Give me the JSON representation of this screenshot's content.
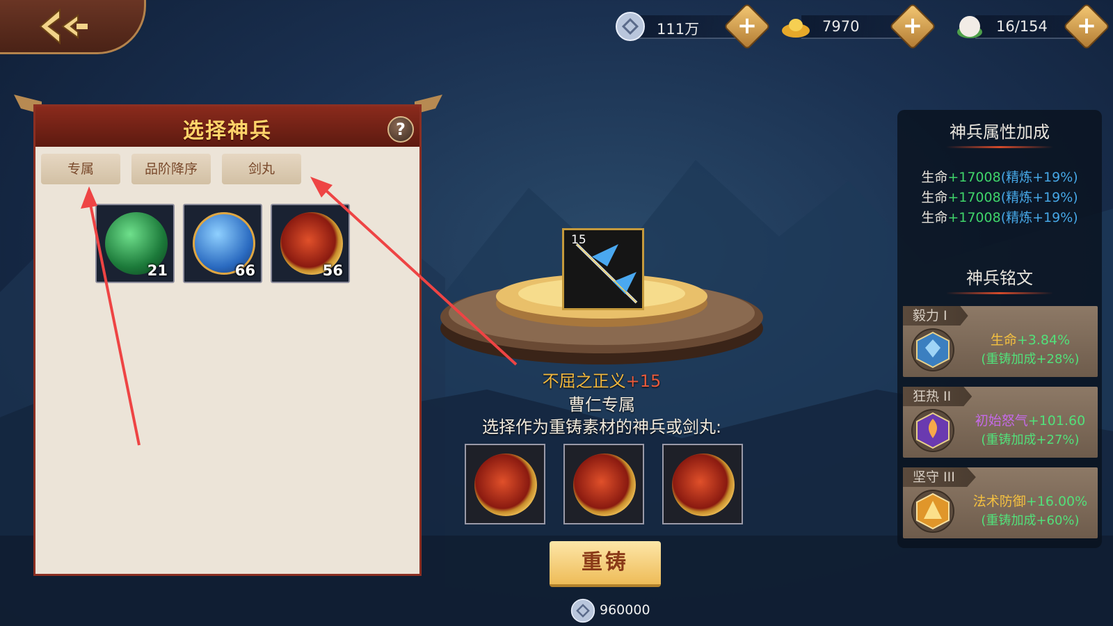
{
  "currency": [
    {
      "icon": "silver-coin-icon",
      "value": "111万"
    },
    {
      "icon": "gold-ingot-icon",
      "value": "7970"
    },
    {
      "icon": "bun-stamina-icon",
      "value": "16/154"
    }
  ],
  "left_panel": {
    "title": "选择神兵",
    "tabs": [
      "专属",
      "品阶降序",
      "剑丸"
    ],
    "items": [
      {
        "icon": "green-orb-icon",
        "count": "21"
      },
      {
        "icon": "blue-orb-icon",
        "count": "66"
      },
      {
        "icon": "red-orb-icon",
        "count": "56"
      }
    ]
  },
  "weapon": {
    "level": "15",
    "name": "不屈之正义",
    "plus": "+15",
    "owner": "曹仁专属",
    "prompt": "选择作为重铸素材的神兵或剑丸:"
  },
  "reforge": {
    "button": "重铸",
    "cost": "960000"
  },
  "right_panel": {
    "attr_title": "神兵属性加成",
    "attrs": [
      {
        "name": "生命",
        "value": "+17008",
        "refine": "(精炼+19%)"
      },
      {
        "name": "生命",
        "value": "+17008",
        "refine": "(精炼+19%)"
      },
      {
        "name": "生命",
        "value": "+17008",
        "refine": "(精炼+19%)"
      }
    ],
    "insc_title": "神兵铭文",
    "inscriptions": [
      {
        "tag": "毅力 I",
        "stat": "生命",
        "value": "+3.84%",
        "bonus": "(重铸加成+28%)"
      },
      {
        "tag": "狂热 II",
        "stat": "初始怒气",
        "value": "+101.60",
        "bonus": "(重铸加成+27%)"
      },
      {
        "tag": "坚守 III",
        "stat": "法术防御",
        "value": "+16.00%",
        "bonus": "(重铸加成+60%)"
      }
    ]
  },
  "colors": {
    "accent_gold": "#f0b73e",
    "panel_red": "#8a2a1c",
    "annotation_arrow": "#ee4444"
  }
}
